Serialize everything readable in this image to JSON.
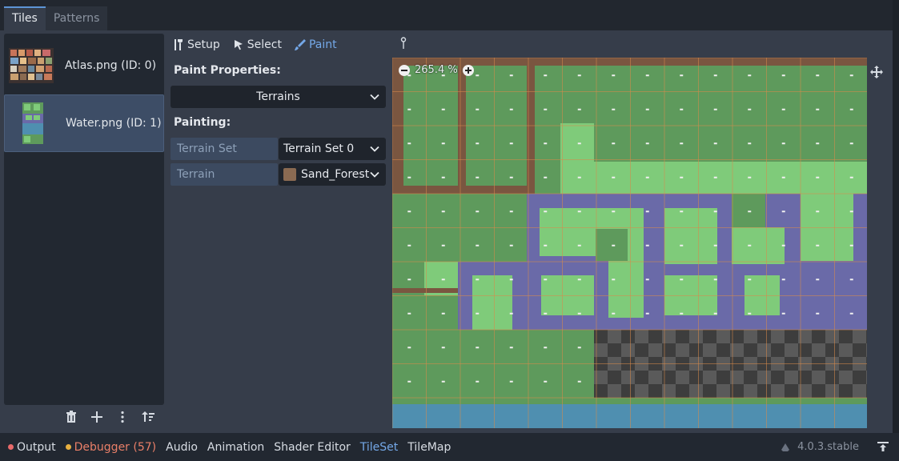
{
  "tabs": [
    {
      "label": "Tiles",
      "active": true
    },
    {
      "label": "Patterns",
      "active": false
    }
  ],
  "sources": [
    {
      "label": "Atlas.png (ID: 0)",
      "selected": false
    },
    {
      "label": "Water.png (ID: 1)",
      "selected": true
    }
  ],
  "toolbar": {
    "setup": "Setup",
    "select": "Select",
    "paint": "Paint"
  },
  "paint_properties": {
    "title": "Paint Properties:",
    "mode": "Terrains"
  },
  "painting": {
    "title": "Painting:",
    "terrain_set_label": "Terrain Set",
    "terrain_set_value": "Terrain Set 0",
    "terrain_label": "Terrain",
    "terrain_value": "Sand_Forest"
  },
  "atlas": {
    "zoom": "265.4 %"
  },
  "dock": {
    "items": [
      "Output",
      "Debugger (57)",
      "Audio",
      "Animation",
      "Shader Editor",
      "TileSet",
      "TileMap"
    ],
    "version": "4.0.3.stable"
  },
  "colors": {
    "accent": "#74a8e8",
    "grass": "#5e9a5c",
    "grass_light": "#7fcb7a",
    "dirt": "#7a5640",
    "water_purple": "#6a6aa8",
    "water_blue": "#4f8fb0"
  }
}
